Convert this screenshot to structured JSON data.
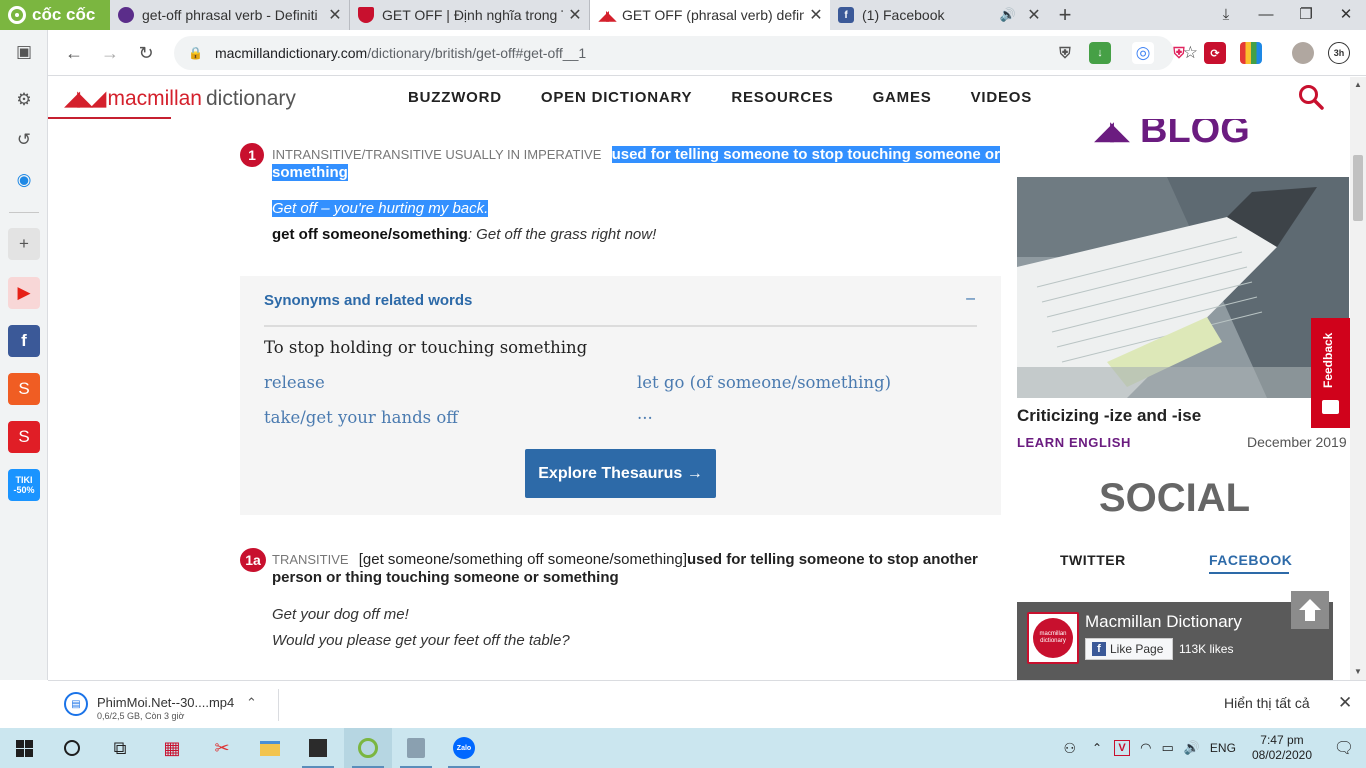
{
  "browser": {
    "brand": "cốc cốc",
    "tabs": [
      {
        "title": "get-off phrasal verb - Definiti",
        "favicon": "purple-circle-icon"
      },
      {
        "title": "GET OFF | Định nghĩa trong Ti",
        "favicon": "cambridge-shield-icon"
      },
      {
        "title": "GET OFF (phrasal verb) definit",
        "favicon": "macmillan-icon",
        "active": true
      },
      {
        "title": "(1) Facebook",
        "favicon": "facebook-icon",
        "audio": true
      }
    ],
    "url_host": "macmillandictionary.com",
    "url_path": "/dictionary/british/get-off#get-off__1",
    "ext_time": "3h"
  },
  "site": {
    "brand_name1": "macmillan",
    "brand_name2": "dictionary",
    "nav": [
      "BUZZWORD",
      "OPEN DICTIONARY",
      "RESOURCES",
      "GAMES",
      "VIDEOS"
    ]
  },
  "entry": {
    "sense1": {
      "num": "1",
      "gram": "INTRANSITIVE/TRANSITIVE  USUALLY IN IMPERATIVE",
      "def": "used for telling someone to stop touching someone or something",
      "ex1": "Get off – you're hurting my back.",
      "ex2_pattern": "get off someone/something",
      "ex2_text": ": Get off the grass right now!"
    },
    "synonyms": {
      "title": "Synonyms and related words",
      "toggle": "–",
      "heading": "To stop holding or touching something",
      "words": [
        "release",
        "let go (of someone/something)",
        "take/get your hands off",
        "..."
      ],
      "button": "Explore Thesaurus →"
    },
    "sense1a": {
      "num": "1a",
      "gram": "TRANSITIVE",
      "pattern": "[get someone/something off someone/something]",
      "def": "used for telling someone to stop another person or thing touching someone or something",
      "ex1": "Get your dog off me!",
      "ex2": "Would you please get your feet off the table?"
    }
  },
  "sidebar": {
    "blog_label": "BLOG",
    "blog_title": "Criticizing -ize and -ise",
    "blog_category": "LEARN ENGLISH",
    "blog_date": "December 2019",
    "social_label": "SOCIAL",
    "twitter_tab": "TWITTER",
    "facebook_tab": "FACEBOOK",
    "fb_page_name": "Macmillan Dictionary",
    "fb_like": "Like Page",
    "fb_likes": "113K likes",
    "feedback": "Feedback"
  },
  "download": {
    "filename": "PhimMoi.Net--30....mp4",
    "status": "0,6/2,5 GB, Còn 3 giờ",
    "show_all": "Hiển thị tất cả"
  },
  "taskbar": {
    "lang": "ENG",
    "time": "7:47 pm",
    "date": "08/02/2020"
  },
  "colors": {
    "accent_red": "#c8102e",
    "link_blue": "#2d6aa8",
    "blog_purple": "#6b1c80",
    "selection": "#3390ff"
  }
}
